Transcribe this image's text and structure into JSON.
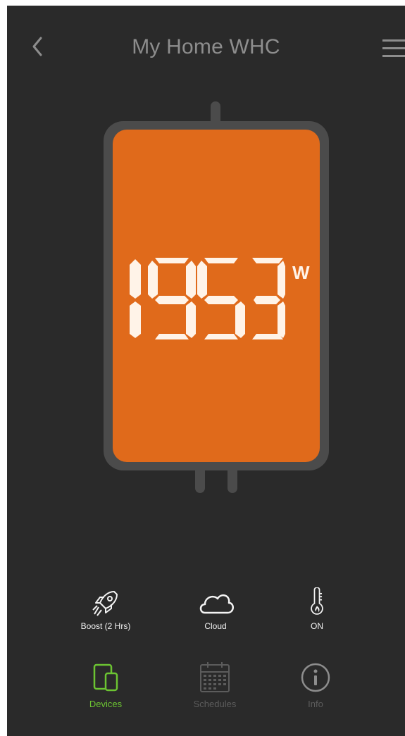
{
  "header": {
    "title": "My Home WHC",
    "back_icon": "chevron-left-icon",
    "menu_icon": "hamburger-menu-icon"
  },
  "display": {
    "value": "1953",
    "unit": "W"
  },
  "controls": [
    {
      "label": "Boost (2 Hrs)",
      "icon": "rocket-icon"
    },
    {
      "label": "Cloud",
      "icon": "cloud-icon"
    },
    {
      "label": "ON",
      "icon": "thermometer-flame-icon"
    }
  ],
  "tabs": [
    {
      "label": "Devices",
      "icon": "devices-icon",
      "active": true
    },
    {
      "label": "Schedules",
      "icon": "calendar-icon",
      "active": false
    },
    {
      "label": "Info",
      "icon": "info-icon",
      "active": false
    }
  ],
  "colors": {
    "background": "#2a2a2a",
    "tank_fill": "#e06a1b",
    "tank_frame": "#4b4b4b",
    "active_tab": "#6cc432",
    "inactive_tab": "#5c5c5c",
    "text_light": "#f3f3f3"
  }
}
